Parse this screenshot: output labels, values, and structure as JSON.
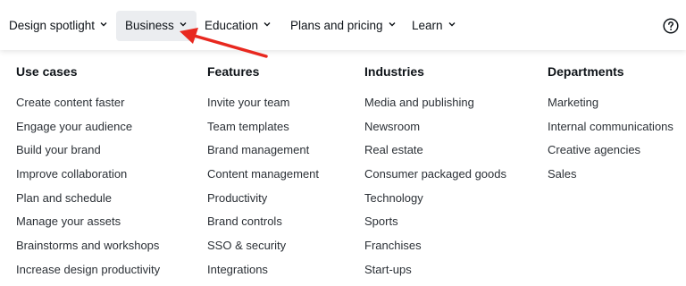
{
  "nav": {
    "items": [
      {
        "label": "Design spotlight"
      },
      {
        "label": "Business"
      },
      {
        "label": "Education"
      },
      {
        "label": "Plans and pricing"
      },
      {
        "label": "Learn"
      }
    ],
    "help_icon": "help-circle-icon"
  },
  "colors": {
    "arrow": "#e8281f",
    "active_bg": "#ebedf0"
  },
  "menu": {
    "columns": [
      {
        "heading": "Use cases",
        "items": [
          "Create content faster",
          "Engage your audience",
          "Build your brand",
          "Improve collaboration",
          "Plan and schedule",
          "Manage your assets",
          "Brainstorms and workshops",
          "Increase design productivity"
        ]
      },
      {
        "heading": "Features",
        "items": [
          "Invite your team",
          "Team templates",
          "Brand management",
          "Content management",
          "Productivity",
          "Brand controls",
          "SSO & security",
          "Integrations"
        ]
      },
      {
        "heading": "Industries",
        "items": [
          "Media and publishing",
          "Newsroom",
          "Real estate",
          "Consumer packaged goods",
          "Technology",
          "Sports",
          "Franchises",
          "Start-ups"
        ]
      },
      {
        "heading": "Departments",
        "items": [
          "Marketing",
          "Internal communications",
          "Creative agencies",
          "Sales"
        ]
      }
    ]
  }
}
